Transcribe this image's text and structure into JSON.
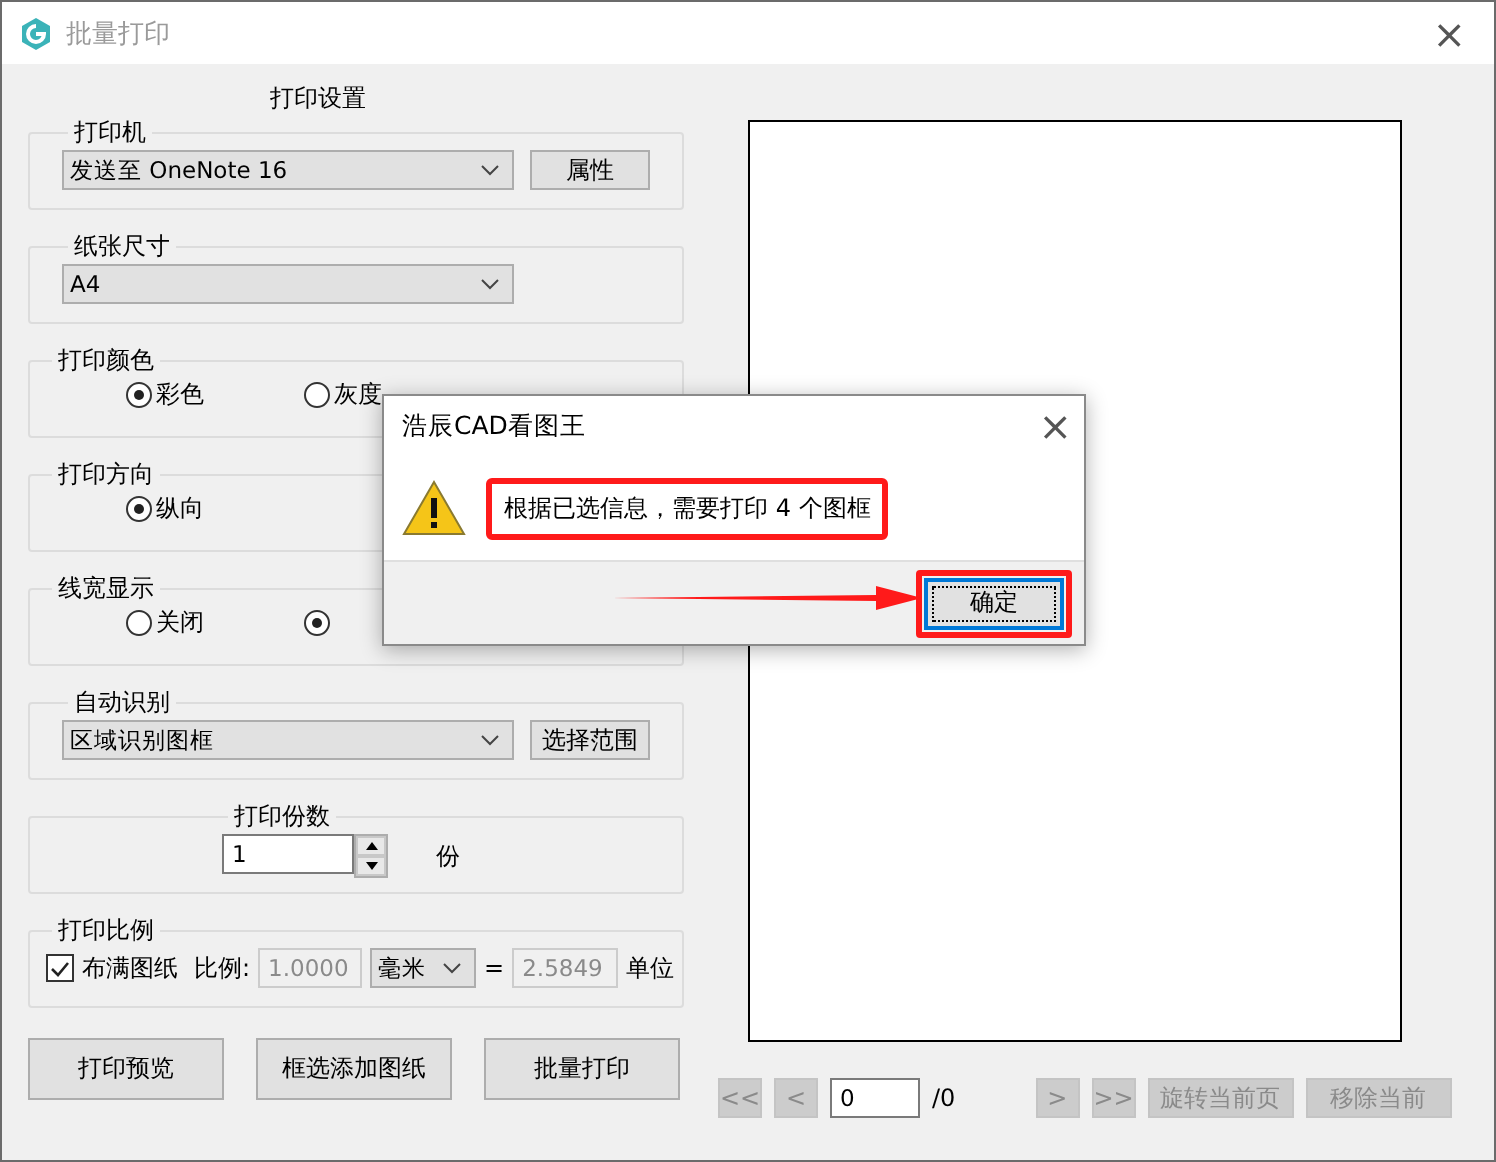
{
  "window": {
    "title": "批量打印",
    "close": "×"
  },
  "settings": {
    "heading": "打印设置",
    "groups": [
      {
        "kind": "select",
        "label": "打印机",
        "value": "发送至 OneNote 16",
        "button": "属性"
      },
      {
        "kind": "select",
        "label": "纸张尺寸",
        "value": "A4"
      },
      {
        "kind": "radios",
        "label": "打印颜色",
        "options": [
          {
            "label": "彩色",
            "selected": true
          },
          {
            "label": "灰度",
            "selected": false
          }
        ]
      },
      {
        "kind": "radios",
        "label": "打印方向",
        "options": [
          {
            "label": "纵向",
            "selected": true
          }
        ]
      },
      {
        "kind": "radios",
        "label": "线宽显示",
        "options": [
          {
            "label": "关闭",
            "selected": false
          },
          {
            "selected": true
          }
        ]
      },
      {
        "kind": "select",
        "label": "自动识别",
        "value": "区域识别图框",
        "button": "选择范围"
      },
      {
        "kind": "count",
        "label": "打印份数",
        "value": "1",
        "unit": "份"
      },
      {
        "kind": "scale",
        "label": "打印比例",
        "fit_label": "布满图纸",
        "fit_checked": true,
        "ratio_label": "比例:",
        "ratio": "1.0000",
        "unit_select": "毫米",
        "equals": "=",
        "units_value": "2.5849",
        "units_label": "单位"
      }
    ]
  },
  "actions": [
    "打印预览",
    "框选添加图纸",
    "批量打印"
  ],
  "pager": {
    "first": "<<",
    "prev": "<",
    "page": "0",
    "total": "/0",
    "next": ">",
    "last": ">>",
    "buttons": [
      "旋转当前页",
      "移除当前"
    ]
  },
  "dialog": {
    "title": "浩辰CAD看图王",
    "close": "×",
    "message": "根据已选信息，需要打印 4 个图框",
    "button": "确定"
  }
}
